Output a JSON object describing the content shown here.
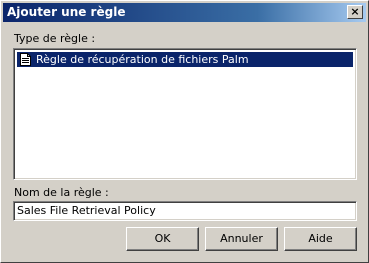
{
  "window": {
    "title": "Ajouter une règle",
    "close_label": "×"
  },
  "rule_type": {
    "label": "Type de règle :",
    "items": [
      {
        "label": "Règle de récupération de fichiers Palm",
        "icon": "document-icon",
        "selected": true
      }
    ]
  },
  "rule_name": {
    "label": "Nom de la règle :",
    "value": "Sales File Retrieval Policy"
  },
  "buttons": {
    "ok": "OK",
    "cancel": "Annuler",
    "help": "Aide"
  },
  "colors": {
    "titlebar": "#0a246a",
    "selection": "#0a246a",
    "face": "#d4d0c8"
  }
}
